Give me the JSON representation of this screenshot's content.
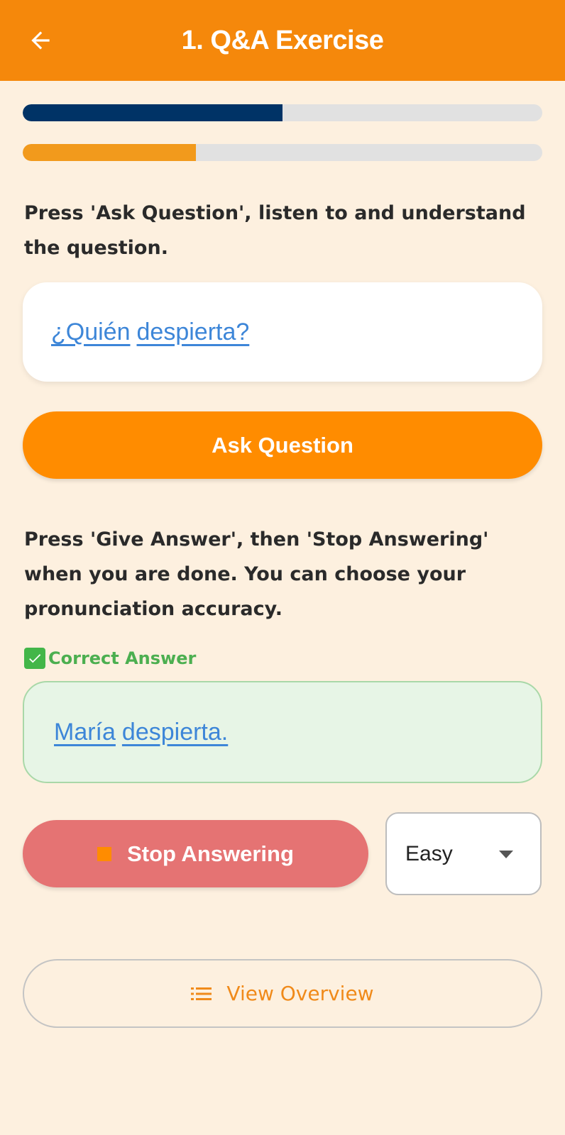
{
  "header": {
    "title": "1. Q&A Exercise",
    "back_icon": "arrow-left-icon",
    "background_color": "#f5880b"
  },
  "progress": [
    {
      "fraction": 0.5,
      "color": "#003366"
    },
    {
      "fraction": 0.333,
      "color": "#f29a1c"
    }
  ],
  "instructions": {
    "ask": "Press 'Ask Question', listen to and understand the question.",
    "answer": "Press 'Give Answer', then 'Stop Answering' when you are done. You can choose your pronunciation accuracy."
  },
  "question": {
    "words": [
      "¿Quién",
      "despierta?"
    ]
  },
  "ask_button": {
    "label": "Ask Question",
    "color": "#ff8c00"
  },
  "correct_answer": {
    "label": "Correct Answer",
    "icon": "check-mark-icon",
    "words": [
      "María",
      "despierta."
    ]
  },
  "stop_button": {
    "label": "Stop Answering",
    "icon": "stop-square-icon",
    "color": "#e57373"
  },
  "accuracy_select": {
    "value": "Easy",
    "icon": "caret-down-icon"
  },
  "overview_button": {
    "label": "View Overview",
    "icon": "list-icon",
    "color": "#f08a1a"
  }
}
